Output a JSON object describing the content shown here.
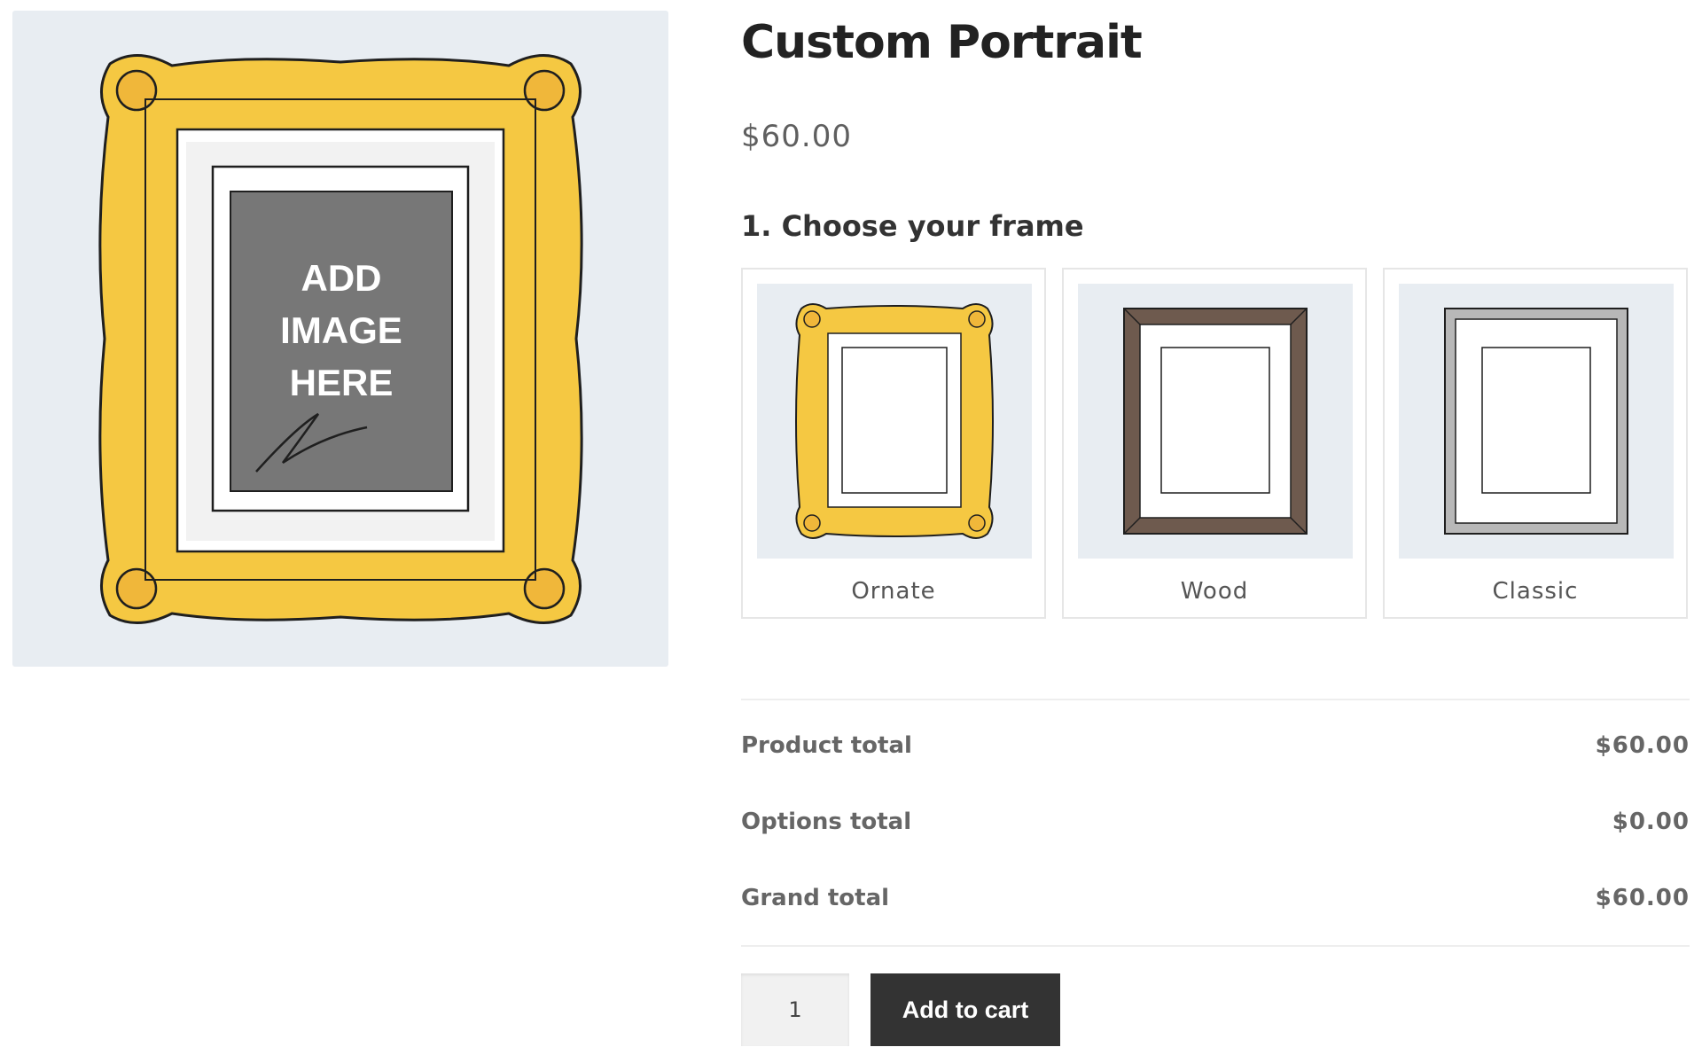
{
  "product": {
    "title": "Custom Portrait",
    "price": "$60.00",
    "image": {
      "placeholder_lines": [
        "ADD",
        "IMAGE",
        "HERE"
      ],
      "frame_color": "#f5c842"
    }
  },
  "options": {
    "heading": "1. Choose your frame",
    "frames": [
      {
        "label": "Ornate",
        "icon": "ornate-frame-icon",
        "color": "#f5c842"
      },
      {
        "label": "Wood",
        "icon": "wood-frame-icon",
        "color": "#6e5a4e"
      },
      {
        "label": "Classic",
        "icon": "classic-frame-icon",
        "color": "#b8b8b8"
      }
    ]
  },
  "totals": {
    "product_total": {
      "label": "Product total",
      "value": "$60.00"
    },
    "options_total": {
      "label": "Options total",
      "value": "$0.00"
    },
    "grand_total": {
      "label": "Grand total",
      "value": "$60.00"
    }
  },
  "cart": {
    "quantity": "1",
    "add_label": "Add to cart"
  },
  "colors": {
    "image_bg": "#e8edf2",
    "button_bg": "#333333",
    "placeholder_gray": "#777777"
  }
}
